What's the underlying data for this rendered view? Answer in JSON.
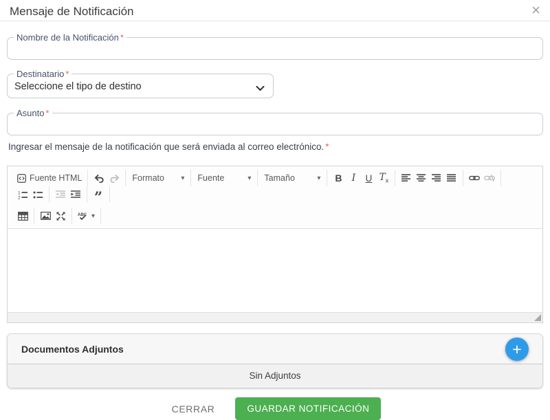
{
  "modal": {
    "title": "Mensaje de Notificación"
  },
  "icons": {
    "close": "×",
    "add": "+",
    "caret_down": "▾",
    "quote": "”"
  },
  "form": {
    "nombre": {
      "label": "Nombre de la Notificación",
      "required": "*",
      "value": ""
    },
    "destinatario": {
      "label": "Destinatario",
      "required": "*",
      "selected": "Seleccione el tipo de destino"
    },
    "asunto": {
      "label": "Asunto",
      "required": "*",
      "value": ""
    },
    "hint": {
      "text": "Ingresar el mensaje de la notificación que será enviada al correo electrónico.",
      "required": "*"
    }
  },
  "editor": {
    "toolbar": {
      "source": "Fuente HTML",
      "format": "Formato",
      "font": "Fuente",
      "size": "Tamaño",
      "bold": "B",
      "italic": "I",
      "underline": "U",
      "removeformat_t": "T",
      "removeformat_x": "x"
    },
    "content": ""
  },
  "attachments": {
    "title": "Documentos Adjuntos",
    "empty": "Sin Adjuntos"
  },
  "actions": {
    "close": "CERRAR",
    "save": "GUARDAR NOTIFICACIÓN"
  },
  "colors": {
    "accent_blue": "#2f9be8",
    "save_green": "#4caf50",
    "required_red": "#f25f5f",
    "label_slate": "#46526b"
  }
}
